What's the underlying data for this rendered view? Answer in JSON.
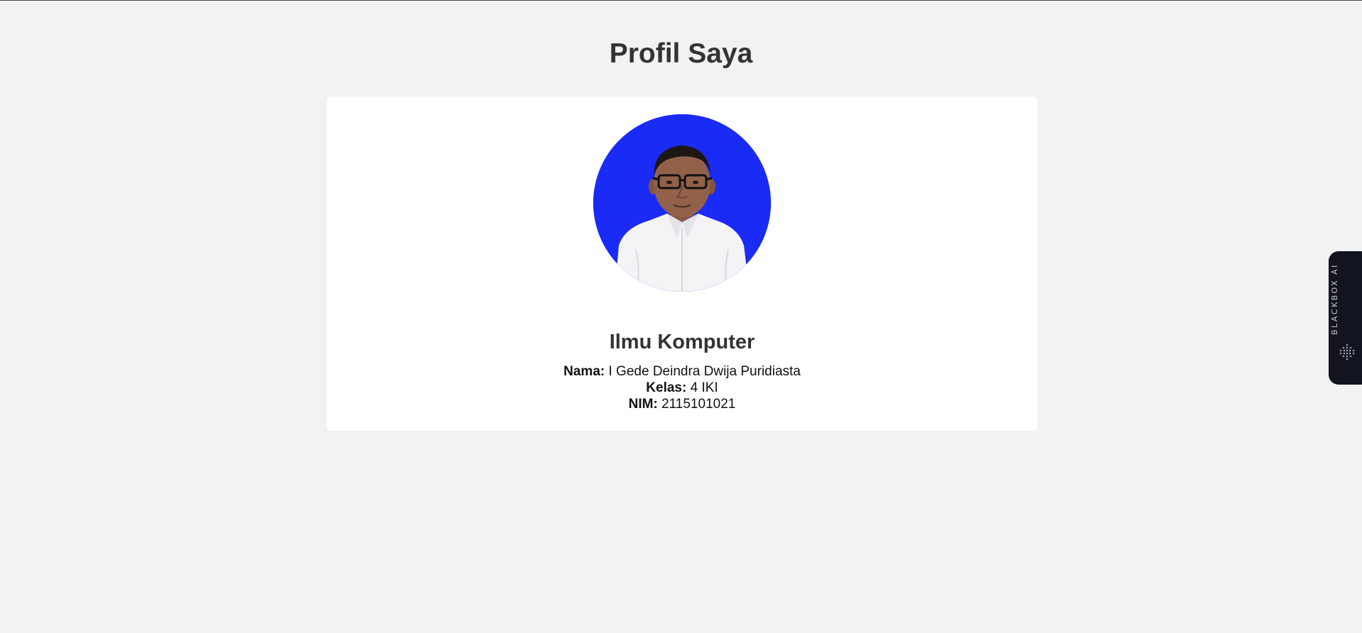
{
  "page": {
    "title": "Profil Saya"
  },
  "profile": {
    "program": "Ilmu Komputer",
    "fields": [
      {
        "label": "Nama:",
        "value": "I Gede Deindra Dwija Puridiasta"
      },
      {
        "label": "Kelas:",
        "value": "4 IKI"
      },
      {
        "label": "NIM:",
        "value": "2115101021"
      }
    ],
    "photo_background": "#1a2bf5"
  },
  "side_tab": {
    "label": "BLACKBOX AI",
    "icon": "blackbox-logo-icon",
    "background": "#12141f"
  },
  "colors": {
    "page_background": "#f2f2f2",
    "card_background": "#ffffff",
    "heading_text": "#333333"
  }
}
